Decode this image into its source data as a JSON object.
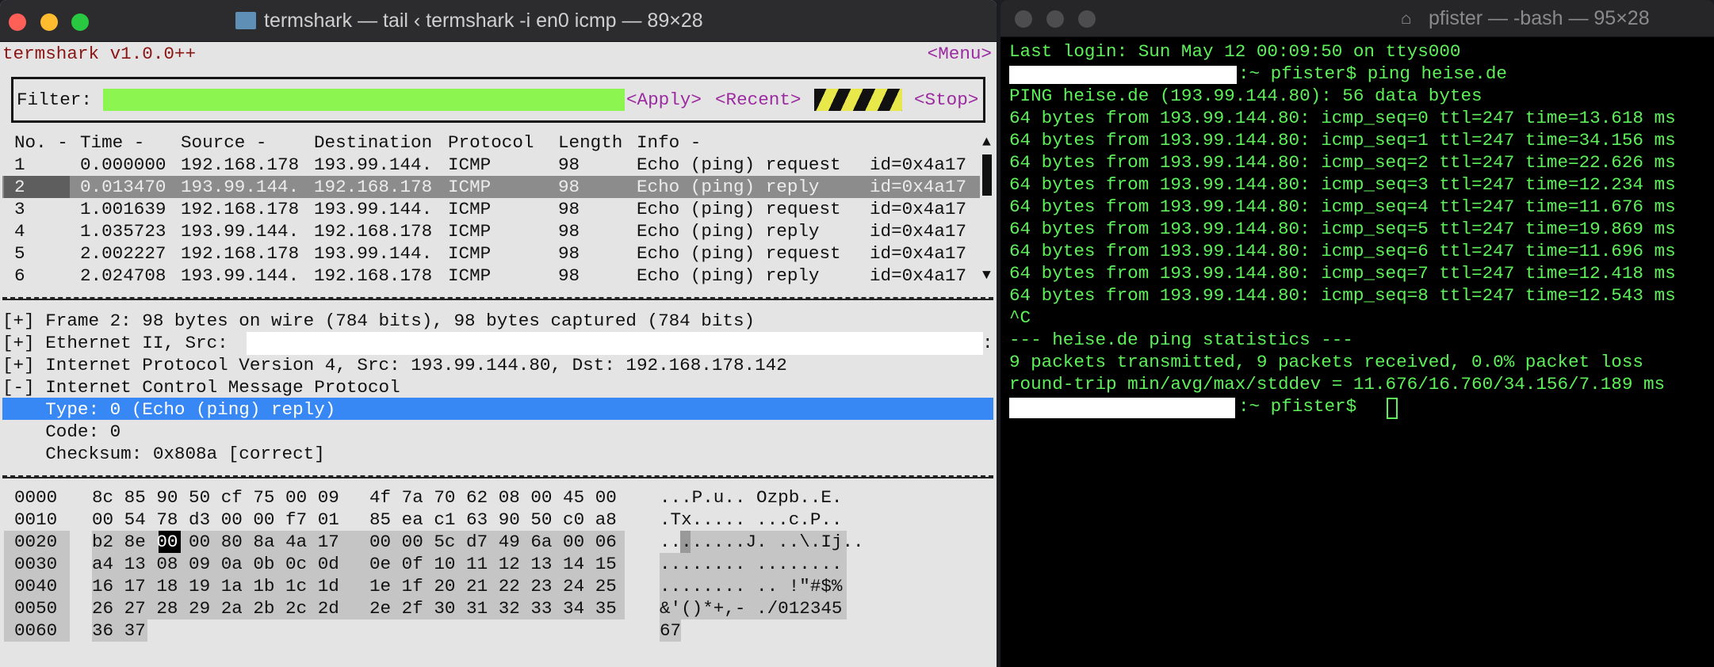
{
  "termshark_window": {
    "title": "termshark — tail ‹ termshark -i en0 icmp — 89×28",
    "app_name": "termshark v1.0.0++",
    "menu_label": "<Menu>",
    "filter_label": "Filter:",
    "filter_value": "",
    "apply_label": "<Apply>",
    "recent_label": "<Recent>",
    "stop_label": "<Stop>",
    "filter_valid_color": "#8df550",
    "columns": [
      "No. -",
      "Time -",
      "Source -",
      "Destination",
      "Protocol",
      "Length",
      "Info -"
    ],
    "packets": [
      {
        "no": "1",
        "time": "0.000000",
        "source": "192.168.178",
        "destination": "193.99.144.",
        "protocol": "ICMP",
        "length": "98",
        "info": "Echo (ping) request",
        "id": "id=0x4a17"
      },
      {
        "no": "2",
        "time": "0.013470",
        "source": "193.99.144.",
        "destination": "192.168.178",
        "protocol": "ICMP",
        "length": "98",
        "info": "Echo (ping) reply",
        "id": "id=0x4a17",
        "selected": true
      },
      {
        "no": "3",
        "time": "1.001639",
        "source": "192.168.178",
        "destination": "193.99.144.",
        "protocol": "ICMP",
        "length": "98",
        "info": "Echo (ping) request",
        "id": "id=0x4a17"
      },
      {
        "no": "4",
        "time": "1.035723",
        "source": "193.99.144.",
        "destination": "192.168.178",
        "protocol": "ICMP",
        "length": "98",
        "info": "Echo (ping) reply",
        "id": "id=0x4a17"
      },
      {
        "no": "5",
        "time": "2.002227",
        "source": "192.168.178",
        "destination": "193.99.144.",
        "protocol": "ICMP",
        "length": "98",
        "info": "Echo (ping) request",
        "id": "id=0x4a17"
      },
      {
        "no": "6",
        "time": "2.024708",
        "source": "193.99.144.",
        "destination": "192.168.178",
        "protocol": "ICMP",
        "length": "98",
        "info": "Echo (ping) reply",
        "id": "id=0x4a17"
      }
    ],
    "details": [
      "[+] Frame 2: 98 bytes on wire (784 bits), 98 bytes captured (784 bits)",
      "[+] Ethernet II, Src:",
      "[+] Internet Protocol Version 4, Src: 193.99.144.80, Dst: 192.168.178.142",
      "[-] Internet Control Message Protocol",
      "    Type: 0 (Echo (ping) reply)",
      "    Code: 0",
      "    Checksum: 0x808a [correct]"
    ],
    "details_trailing": ":",
    "hex_rows": [
      {
        "offset": "0000",
        "hex1": "8c 85 90 50 cf 75 00 09",
        "hex2": "4f 7a 70 62 08 00 45 00",
        "ascii": "...P.u.. Ozpb..E."
      },
      {
        "offset": "0010",
        "hex1": "00 54 78 d3 00 00 f7 01",
        "hex2": "85 ea c1 63 90 50 c0 a8",
        "ascii": ".Tx..... ...c.P.."
      },
      {
        "offset": "0020",
        "hex1": "b2 8e 00 00 80 8a 4a 17",
        "hex2": "00 00 5c d7 49 6a 00 06",
        "ascii": "........J. ..\\.Ij.."
      },
      {
        "offset": "0030",
        "hex1": "a4 13 08 09 0a 0b 0c 0d",
        "hex2": "0e 0f 10 11 12 13 14 15",
        "ascii": "........ ........"
      },
      {
        "offset": "0040",
        "hex1": "16 17 18 19 1a 1b 1c 1d",
        "hex2": "1e 1f 20 21 22 23 24 25",
        "ascii": "........ .. !\"#$%"
      },
      {
        "offset": "0050",
        "hex1": "26 27 28 29 2a 2b 2c 2d",
        "hex2": "2e 2f 30 31 32 33 34 35",
        "ascii": "&'()*+,- ./012345"
      },
      {
        "offset": "0060",
        "hex1": "36 37",
        "hex2": "",
        "ascii": "67"
      }
    ]
  },
  "bash_window": {
    "title": "pfister — -bash — 95×28",
    "lines": [
      "Last login: Sun May 12 00:09:50 on ttys000",
      ":~ pfister$ ping heise.de",
      "PING heise.de (193.99.144.80): 56 data bytes",
      "64 bytes from 193.99.144.80: icmp_seq=0 ttl=247 time=13.618 ms",
      "64 bytes from 193.99.144.80: icmp_seq=1 ttl=247 time=34.156 ms",
      "64 bytes from 193.99.144.80: icmp_seq=2 ttl=247 time=22.626 ms",
      "64 bytes from 193.99.144.80: icmp_seq=3 ttl=247 time=12.234 ms",
      "64 bytes from 193.99.144.80: icmp_seq=4 ttl=247 time=11.676 ms",
      "64 bytes from 193.99.144.80: icmp_seq=5 ttl=247 time=19.869 ms",
      "64 bytes from 193.99.144.80: icmp_seq=6 ttl=247 time=11.696 ms",
      "64 bytes from 193.99.144.80: icmp_seq=7 ttl=247 time=12.418 ms",
      "64 bytes from 193.99.144.80: icmp_seq=8 ttl=247 time=12.543 ms",
      "^C",
      "--- heise.de ping statistics ---",
      "9 packets transmitted, 9 packets received, 0.0% packet loss",
      "round-trip min/avg/max/stddev = 11.676/16.760/34.156/7.189 ms",
      ":~ pfister$"
    ],
    "text_color": "#5ef05a"
  }
}
